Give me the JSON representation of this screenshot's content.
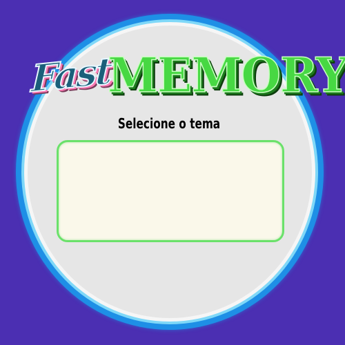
{
  "game": {
    "title_part1": "Fast",
    "title_part2": "MEMORY",
    "prompt": "Selecione o tema"
  },
  "colors": {
    "background": "#4b2fb2",
    "ring_outer": "#1e8fe6",
    "ring_mid": "#7fd8f8",
    "disc": "#e6e6e6",
    "box_border": "#6ae16a",
    "box_fill": "#faf8ea",
    "logo_fast": "#1b5f7a",
    "logo_memory": "#47d843"
  },
  "theme_selector": {
    "options": []
  }
}
